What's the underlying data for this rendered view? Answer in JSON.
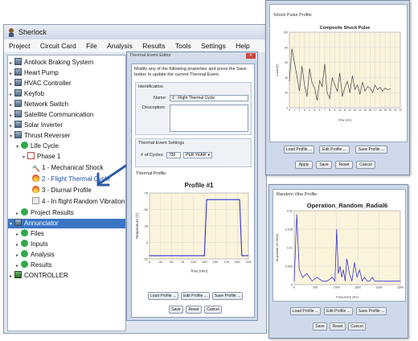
{
  "app": {
    "title": "Sherlock",
    "menu": [
      "Project",
      "Circuit Card",
      "File",
      "Analysis",
      "Results",
      "Tools",
      "Settings",
      "Help"
    ]
  },
  "tree": {
    "items": [
      {
        "label": "Antilock Braking System",
        "icon": "circuit-card-icon"
      },
      {
        "label": "Heart Pump",
        "icon": "circuit-card-icon"
      },
      {
        "label": "HVAC Controller",
        "icon": "circuit-card-icon"
      },
      {
        "label": "Keyfob",
        "icon": "circuit-card-icon"
      },
      {
        "label": "Network Switch",
        "icon": "circuit-card-icon"
      },
      {
        "label": "Satellite Communication",
        "icon": "circuit-card-icon"
      },
      {
        "label": "Solar Inverter",
        "icon": "circuit-card-icon"
      },
      {
        "label": "Thrust Reverser",
        "icon": "circuit-card-icon"
      },
      {
        "label": "Life Cycle",
        "icon": "check-icon"
      },
      {
        "label": "Phase 1",
        "icon": "phase-icon"
      },
      {
        "label": "1 - Mechanical Shock",
        "icon": "hammer-icon"
      },
      {
        "label": "2 - Flight Thermal Cycle",
        "icon": "flame-icon"
      },
      {
        "label": "3 - Diurnal Profile",
        "icon": "flame-icon"
      },
      {
        "label": "4 - In flight Random Vibration",
        "icon": "vibration-icon"
      },
      {
        "label": "Project Results",
        "icon": "check-icon"
      },
      {
        "label": "Annunciator",
        "icon": "circuit-card-icon"
      },
      {
        "label": "Files",
        "icon": "check-icon"
      },
      {
        "label": "Inputs",
        "icon": "check-icon"
      },
      {
        "label": "Analysis",
        "icon": "check-icon"
      },
      {
        "label": "Results",
        "icon": "check-icon"
      },
      {
        "label": "CONTROLLER",
        "icon": "circuit-card-icon"
      }
    ]
  },
  "thermal": {
    "title": "Thermal Event Editor",
    "instructions": "Modify any of the following properties and press the Save button to update the current Thermal Event.",
    "identification_label": "Identification",
    "name_label": "Name:",
    "name_value": "2 - Flight Thermal Cycle",
    "description_label": "Description:",
    "settings_label": "Thermal Event Settings",
    "cycles_label": "# of Cycles:",
    "cycles_value": "730",
    "cycles_unit": "PER YEAR",
    "profile_section_label": "Thermal Profile",
    "load_profile": "Load Profile ...",
    "edit_profile": "Edit Profile ...",
    "save_profile": "Save Profile ...",
    "save": "Save",
    "reset": "Reset",
    "cancel": "Cancel"
  },
  "shock": {
    "section_label": "Shock Pulse Profile",
    "load_profile": "Load Profile ...",
    "edit_profile": "Edit Profile ...",
    "save_profile": "Save Profile ...",
    "apply": "Apply",
    "save": "Save",
    "reset": "Reset",
    "cancel": "Cancel"
  },
  "vibe": {
    "section_label": "Random Vibe Profile",
    "load_profile": "Load Profile ...",
    "edit_profile": "Edit Profile ...",
    "save_profile": "Save Profile ...",
    "save": "Save",
    "reset": "Reset",
    "cancel": "Cancel"
  },
  "chart_data": [
    {
      "type": "line",
      "title": "Profile #1",
      "xlabel": "Time (min)",
      "ylabel": "Temperature (C)",
      "xlim": [
        0,
        225
      ],
      "ylim": [
        -25,
        75
      ],
      "xticks": [
        0,
        25,
        50,
        75,
        100,
        125,
        150,
        175,
        200,
        225
      ],
      "yticks": [
        -25,
        0,
        25,
        50,
        75
      ],
      "x": [
        0,
        125,
        130,
        205,
        210,
        225
      ],
      "y": [
        -20,
        -20,
        65,
        65,
        -20,
        -20
      ],
      "color": "#3030d0"
    },
    {
      "type": "line",
      "title": "Composite Shock Pulse",
      "xlabel": "Time (ms)",
      "ylabel": "Load (G)",
      "xlim": [
        0,
        22
      ],
      "ylim": [
        0,
        100
      ],
      "xticks": [
        0,
        1,
        2,
        3,
        4,
        5,
        6,
        7,
        8,
        9,
        10,
        11,
        12,
        13,
        14,
        15,
        16,
        17,
        18,
        19,
        20,
        21,
        22
      ],
      "yticks": [
        0,
        20,
        40,
        60,
        80,
        100
      ],
      "x": [
        0,
        0.5,
        1,
        1.5,
        2,
        2.5,
        3,
        3.5,
        4,
        4.5,
        5,
        5.5,
        6,
        6.5,
        7,
        7.5,
        8,
        8.5,
        9,
        9.5,
        10,
        10.5,
        11,
        11.5,
        12,
        12.5,
        13,
        13.5,
        14,
        14.5,
        15,
        15.5,
        16,
        16.5,
        17,
        17.5,
        18,
        18.5,
        19,
        19.5,
        20
      ],
      "y": [
        35,
        78,
        60,
        42,
        22,
        55,
        30,
        15,
        52,
        33,
        26,
        10,
        36,
        28,
        58,
        20,
        12,
        40,
        30,
        22,
        46,
        15,
        27,
        35,
        20,
        42,
        24,
        30,
        18,
        34,
        22,
        28,
        26,
        20,
        30,
        24,
        27,
        22,
        26,
        24,
        25
      ],
      "color": "#444444"
    },
    {
      "type": "line",
      "title": "Operation_Random_Radial6",
      "xlabel": "Frequency (Hz)",
      "ylabel": "Amplitude (G^2/Hz)",
      "xlim": [
        0,
        2500
      ],
      "ylim": [
        0,
        0.02
      ],
      "xticks": [
        0,
        500,
        1000,
        1500,
        2000,
        2500
      ],
      "yticks": [
        0,
        0.005,
        0.01,
        0.015,
        0.02
      ],
      "x": [
        0,
        60,
        120,
        200,
        300,
        420,
        540,
        660,
        780,
        900,
        960,
        1000,
        1040,
        1080,
        1120,
        1160,
        1200,
        1240,
        1300,
        1360,
        1420,
        1480,
        1540,
        1600,
        1660,
        1720,
        1780,
        1840,
        1900,
        1960,
        2020,
        2080,
        2140,
        2200,
        2260,
        2320,
        2380,
        2440,
        2500
      ],
      "y": [
        0.001,
        0.019,
        0.004,
        0.002,
        0.003,
        0.001,
        0.002,
        0.001,
        0.001,
        0.002,
        0.001,
        0.015,
        0.003,
        0.005,
        0.002,
        0.004,
        0.001,
        0.007,
        0.003,
        0.001,
        0.006,
        0.002,
        0.004,
        0.001,
        0.002,
        0.001,
        0.001,
        0.002,
        0.001,
        0.001,
        0.001,
        0.001,
        0.001,
        0.001,
        0.001,
        0.001,
        0.001,
        0.001,
        0.001
      ],
      "color": "#2020d0"
    }
  ]
}
